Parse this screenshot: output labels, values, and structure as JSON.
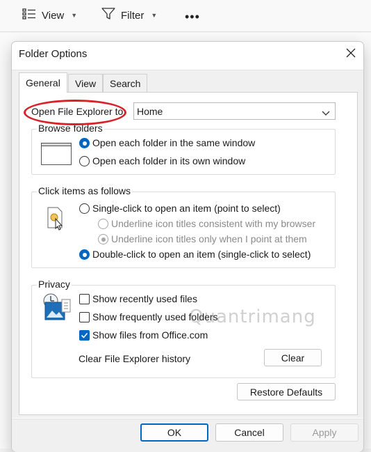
{
  "toolbar": {
    "view_label": "View",
    "filter_label": "Filter",
    "more_label": "•••"
  },
  "dialog": {
    "title": "Folder Options",
    "tabs": [
      {
        "label": "General",
        "active": true
      },
      {
        "label": "View",
        "active": false
      },
      {
        "label": "Search",
        "active": false
      }
    ],
    "open_to": {
      "label": "Open File Explorer to:",
      "value": "Home"
    },
    "browse": {
      "group_label": "Browse folders",
      "option_same": "Open each folder in the same window",
      "option_own": "Open each folder in its own window",
      "selected": "same"
    },
    "click": {
      "group_label": "Click items as follows",
      "single": "Single-click to open an item (point to select)",
      "underline_browser": "Underline icon titles consistent with my browser",
      "underline_point": "Underline icon titles only when I point at them",
      "double": "Double-click to open an item (single-click to select)",
      "selected": "double"
    },
    "privacy": {
      "group_label": "Privacy",
      "recent_files": "Show recently used files",
      "frequent_folders": "Show frequently used folders",
      "office_files": "Show files from Office.com",
      "clear_history_label": "Clear File Explorer history",
      "clear_button": "Clear",
      "recent_checked": false,
      "frequent_checked": false,
      "office_checked": true
    },
    "restore_button": "Restore Defaults",
    "ok_button": "OK",
    "cancel_button": "Cancel",
    "apply_button": "Apply"
  },
  "watermark": "Quantrimang",
  "colors": {
    "accent": "#0067c0",
    "annotation": "#d6232a"
  }
}
